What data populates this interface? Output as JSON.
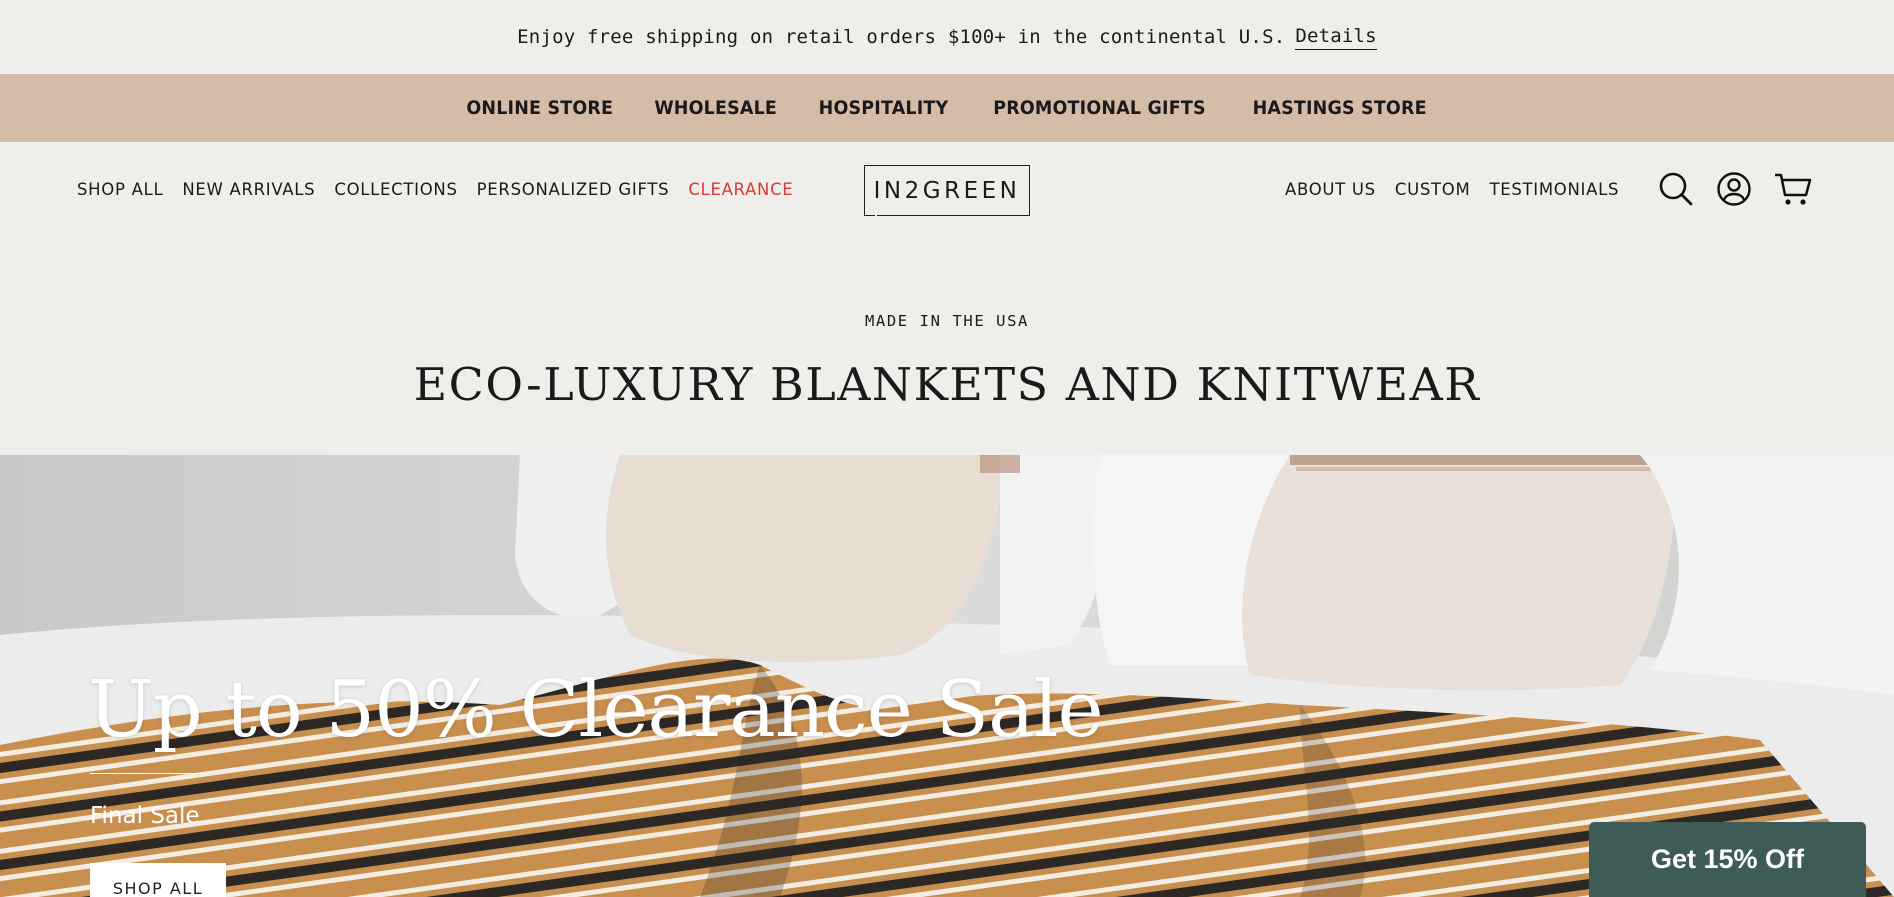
{
  "announcement": {
    "text": "Enjoy free shipping on retail orders $100+ in the continental U.S.",
    "link": "Details"
  },
  "top_nav": {
    "items": [
      "ONLINE STORE",
      "WHOLESALE",
      "HOSPITALITY",
      "PROMOTIONAL GIFTS",
      "HASTINGS STORE"
    ]
  },
  "main_nav": {
    "left": [
      "SHOP ALL",
      "NEW ARRIVALS",
      "COLLECTIONS",
      "PERSONALIZED GIFTS",
      "CLEARANCE"
    ],
    "right": [
      "ABOUT US",
      "CUSTOM",
      "TESTIMONIALS"
    ],
    "logo": "IN2GREEN",
    "icons": [
      "search-icon",
      "account-icon",
      "cart-icon"
    ]
  },
  "hero": {
    "eyebrow": "MADE IN THE USA",
    "headline": "ECO-LUXURY BLANKETS AND KNITWEAR"
  },
  "banner": {
    "title": "Up to 50% Clearance Sale",
    "subtitle": "Final Sale",
    "button": "SHOP ALL"
  },
  "popup": {
    "label": "Get 15% Off"
  },
  "colors": {
    "background": "#f0eeea",
    "top_nav_bg": "#d3bda8",
    "clearance": "#d43a3a",
    "popup_bg": "#3f5b57"
  }
}
